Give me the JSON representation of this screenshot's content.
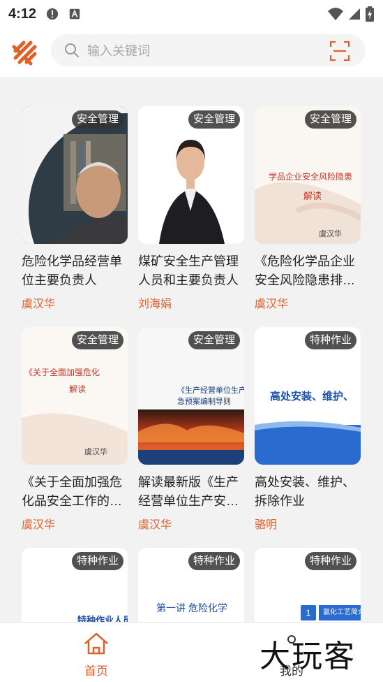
{
  "status_bar": {
    "time": "4:12"
  },
  "header": {
    "search_placeholder": "输入关键词"
  },
  "courses": [
    {
      "badge": "安全管理",
      "title": "危险化学品经营单位主要负责人",
      "author": "虞汉华",
      "thumb": "portrait-man"
    },
    {
      "badge": "安全管理",
      "title": "煤矿安全生产管理人员和主要负责人",
      "author": "刘海娟",
      "thumb": "portrait-woman"
    },
    {
      "badge": "安全管理",
      "title": "《危险化学品企业安全风险隐患排…",
      "author": "虞汉华",
      "thumb": "slide-red",
      "slide_text": "学品企业安全风险隐患",
      "slide_sub": "解读",
      "slide_name": "虞汉华"
    },
    {
      "badge": "安全管理",
      "title": "《关于全面加强危化品安全工作的…",
      "author": "虞汉华",
      "thumb": "slide-red",
      "slide_text": "《关于全面加强危化",
      "slide_sub": "解读",
      "slide_name": "虞汉华"
    },
    {
      "badge": "安全管理",
      "title": "解读最新版《生产经营单位生产安…",
      "author": "虞汉华",
      "thumb": "slide-fire",
      "slide_text": "《生产经营单位生产",
      "slide_sub": "急预案编制导则"
    },
    {
      "badge": "特种作业",
      "title": "高处安装、维护、拆除作业",
      "author": "骆明",
      "thumb": "slide-blue",
      "slide_text": "高处安装、维护、"
    },
    {
      "badge": "特种作业",
      "title": "",
      "author": "",
      "thumb": "slide-text",
      "slide_text": "特种作业人员"
    },
    {
      "badge": "特种作业",
      "title": "",
      "author": "",
      "thumb": "slide-text",
      "slide_text": "第一讲 危险化学"
    },
    {
      "badge": "特种作业",
      "title": "",
      "author": "",
      "thumb": "slide-num",
      "slide_text": "氯化工艺简介",
      "slide_num": "1"
    }
  ],
  "bottom_nav": {
    "home_label": "首页",
    "mine_label": "我的",
    "watermark": "大玩客"
  },
  "colors": {
    "accent": "#e0602a",
    "badge_bg": "#323232"
  }
}
